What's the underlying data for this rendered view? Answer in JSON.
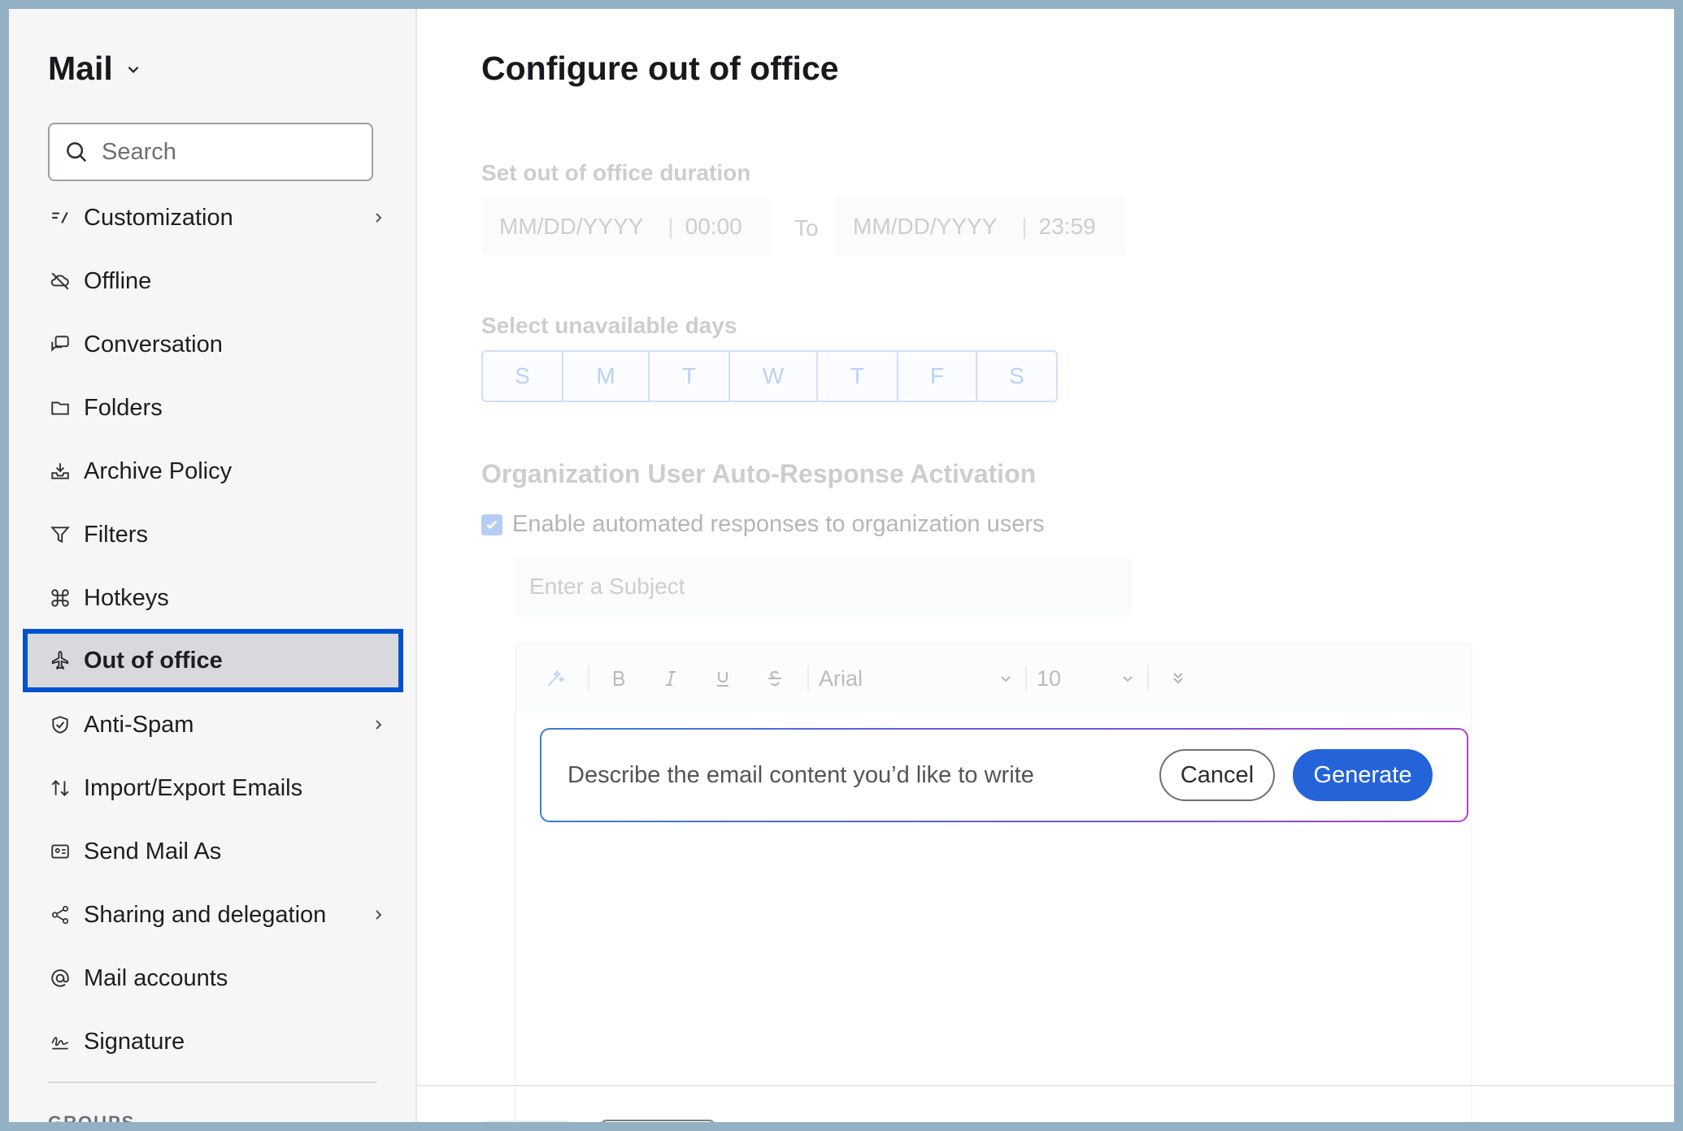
{
  "sidebar": {
    "app_title": "Mail",
    "search_placeholder": "Search",
    "items": [
      {
        "label": "Customization",
        "icon": "customization-icon",
        "has_arrow": true
      },
      {
        "label": "Offline",
        "icon": "cloud-off-icon",
        "has_arrow": false
      },
      {
        "label": "Conversation",
        "icon": "conversation-icon",
        "has_arrow": false
      },
      {
        "label": "Folders",
        "icon": "folder-icon",
        "has_arrow": false
      },
      {
        "label": "Archive Policy",
        "icon": "archive-icon",
        "has_arrow": false
      },
      {
        "label": "Filters",
        "icon": "filter-icon",
        "has_arrow": false
      },
      {
        "label": "Hotkeys",
        "icon": "command-icon",
        "has_arrow": false
      },
      {
        "label": "Out of office",
        "icon": "airplane-icon",
        "has_arrow": false,
        "selected": true
      },
      {
        "label": "Anti-Spam",
        "icon": "shield-icon",
        "has_arrow": true
      },
      {
        "label": "Import/Export Emails",
        "icon": "import-export-icon",
        "has_arrow": false
      },
      {
        "label": "Send Mail As",
        "icon": "send-as-icon",
        "has_arrow": false
      },
      {
        "label": "Sharing and delegation",
        "icon": "share-icon",
        "has_arrow": true
      },
      {
        "label": "Mail accounts",
        "icon": "at-icon",
        "has_arrow": false
      },
      {
        "label": "Signature",
        "icon": "signature-icon",
        "has_arrow": false
      }
    ],
    "groups_label": "GROUPS"
  },
  "main": {
    "title": "Configure out of office",
    "duration": {
      "label": "Set out of office duration",
      "start_date_placeholder": "MM/DD/YYYY",
      "start_time": "00:00",
      "to_label": "To",
      "end_date_placeholder": "MM/DD/YYYY",
      "end_time": "23:59"
    },
    "unavailable_days": {
      "label": "Select unavailable days",
      "days": [
        "S",
        "M",
        "T",
        "W",
        "T",
        "F",
        "S"
      ]
    },
    "org_auto_response": {
      "heading": "Organization User Auto-Response Activation",
      "checkbox_label": "Enable automated responses to organization users",
      "checked": true,
      "subject_placeholder": "Enter a Subject"
    },
    "editor": {
      "font": "Arial",
      "size": "10"
    },
    "ai_prompt": {
      "placeholder": "Describe the email content you’d like to write",
      "cancel_label": "Cancel",
      "generate_label": "Generate"
    }
  },
  "colors": {
    "accent": "#2563d8",
    "selection_border": "#0052cc",
    "frame_bg": "#94b1c4"
  }
}
